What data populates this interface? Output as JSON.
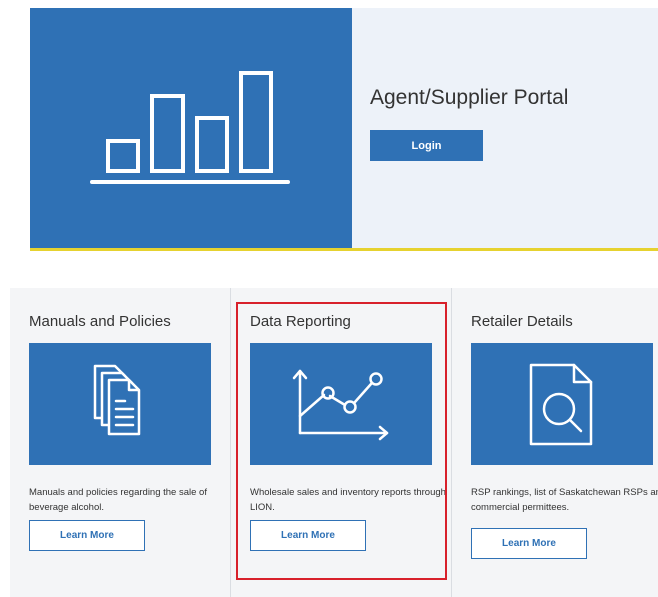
{
  "hero": {
    "title": "Agent/Supplier Portal",
    "login_label": "Login",
    "icon": "bar-chart-icon"
  },
  "cards": [
    {
      "title": "Manuals and Policies",
      "icon": "documents-icon",
      "description": "Manuals and policies regarding the sale of beverage alcohol.",
      "button_label": "Learn More"
    },
    {
      "title": "Data Reporting",
      "icon": "line-chart-icon",
      "description": "Wholesale sales and inventory reports through LION.",
      "button_label": "Learn More",
      "highlighted": true
    },
    {
      "title": "Retailer Details",
      "icon": "document-search-icon",
      "description": "RSP rankings, list of Saskatchewan RSPs and commercial permittees.",
      "button_label": "Learn More"
    }
  ],
  "colors": {
    "primary_blue": "#2f71b5",
    "accent_yellow": "#e6d22f",
    "highlight_red": "#d8212b",
    "hero_panel": "#edf2f9",
    "card_background": "#f4f5f7"
  }
}
